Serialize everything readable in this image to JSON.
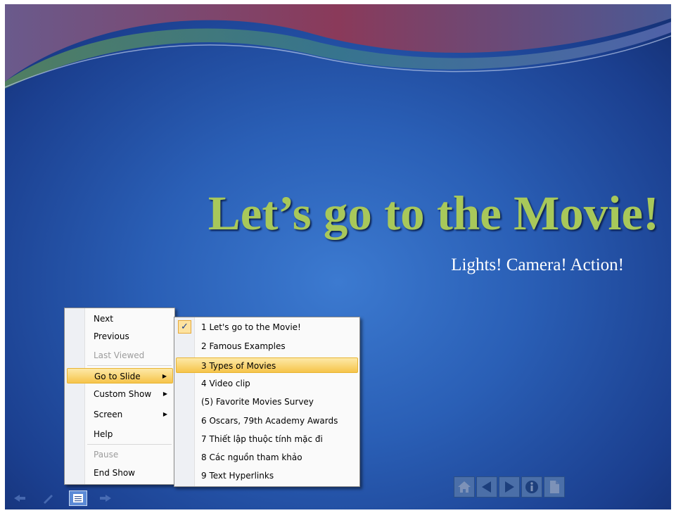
{
  "slide": {
    "title": "Let’s go to the Movie!",
    "subtitle": "Lights! Camera! Action!"
  },
  "context_menu": {
    "items": [
      {
        "label": "Next",
        "state": "normal"
      },
      {
        "label": "Previous",
        "state": "normal"
      },
      {
        "label": "Last Viewed",
        "state": "disabled"
      },
      {
        "label": "Go to Slide",
        "state": "highlighted",
        "submenu": true
      },
      {
        "label": "Custom Show",
        "state": "normal",
        "submenu": true
      },
      {
        "label": "Screen",
        "state": "normal",
        "submenu": true
      },
      {
        "label": "Help",
        "state": "normal"
      },
      {
        "label": "Pause",
        "state": "disabled"
      },
      {
        "label": "End Show",
        "state": "normal"
      }
    ]
  },
  "goto_submenu": {
    "items": [
      {
        "label": "1 Let's go to the Movie!",
        "checked": true
      },
      {
        "label": "2 Famous Examples"
      },
      {
        "label": "3 Types of Movies",
        "highlighted": true
      },
      {
        "label": "4 Video clip"
      },
      {
        "label": "(5) Favorite Movies Survey"
      },
      {
        "label": "6 Oscars, 79th Academy Awards"
      },
      {
        "label": "7 Thiết lập thuộc tính mặc đi"
      },
      {
        "label": "8 Các nguồn tham khảo"
      },
      {
        "label": "9 Text Hyperlinks"
      }
    ]
  },
  "nav_buttons": [
    "home-icon",
    "back-arrow-icon",
    "forward-arrow-icon",
    "info-icon",
    "document-icon"
  ],
  "slideshow_toolbar": [
    "previous-arrow-icon",
    "pen-icon",
    "menu-icon",
    "next-arrow-icon"
  ],
  "colors": {
    "title": "#a8c85a",
    "background": "#2a5fb6",
    "menu_highlight": "#f6c44a"
  }
}
